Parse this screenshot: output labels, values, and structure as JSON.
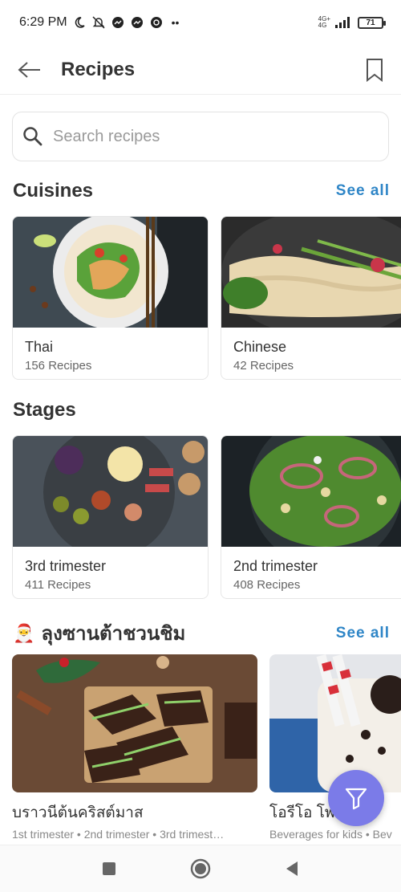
{
  "status_bar": {
    "time": "6:29 PM",
    "network_top": "4G+",
    "network_bottom": "4G",
    "battery": "71",
    "more": "••"
  },
  "app_bar": {
    "title": "Recipes"
  },
  "search": {
    "placeholder": "Search recipes"
  },
  "cuisines": {
    "title": "Cuisines",
    "see_all": "See all",
    "items": [
      {
        "name": "Thai",
        "count": "156 Recipes"
      },
      {
        "name": "Chinese",
        "count": "42 Recipes"
      }
    ]
  },
  "stages": {
    "title": "Stages",
    "items": [
      {
        "name": "3rd trimester",
        "count": "411 Recipes"
      },
      {
        "name": "2nd trimester",
        "count": "408 Recipes"
      }
    ]
  },
  "christmas": {
    "emoji": "🎅",
    "title": "ลุงซานต้าชวนชิม",
    "see_all": "See all",
    "items": [
      {
        "name": "บราวนีต้นคริสต์มาส",
        "tags": "1st trimester • 2nd trimester • 3rd trimest…"
      },
      {
        "name": "โอรีโอ โพ",
        "tags": "Beverages for kids • Bev"
      }
    ]
  },
  "colors": {
    "accent": "#2f86c7",
    "fab": "#7b7be8"
  }
}
